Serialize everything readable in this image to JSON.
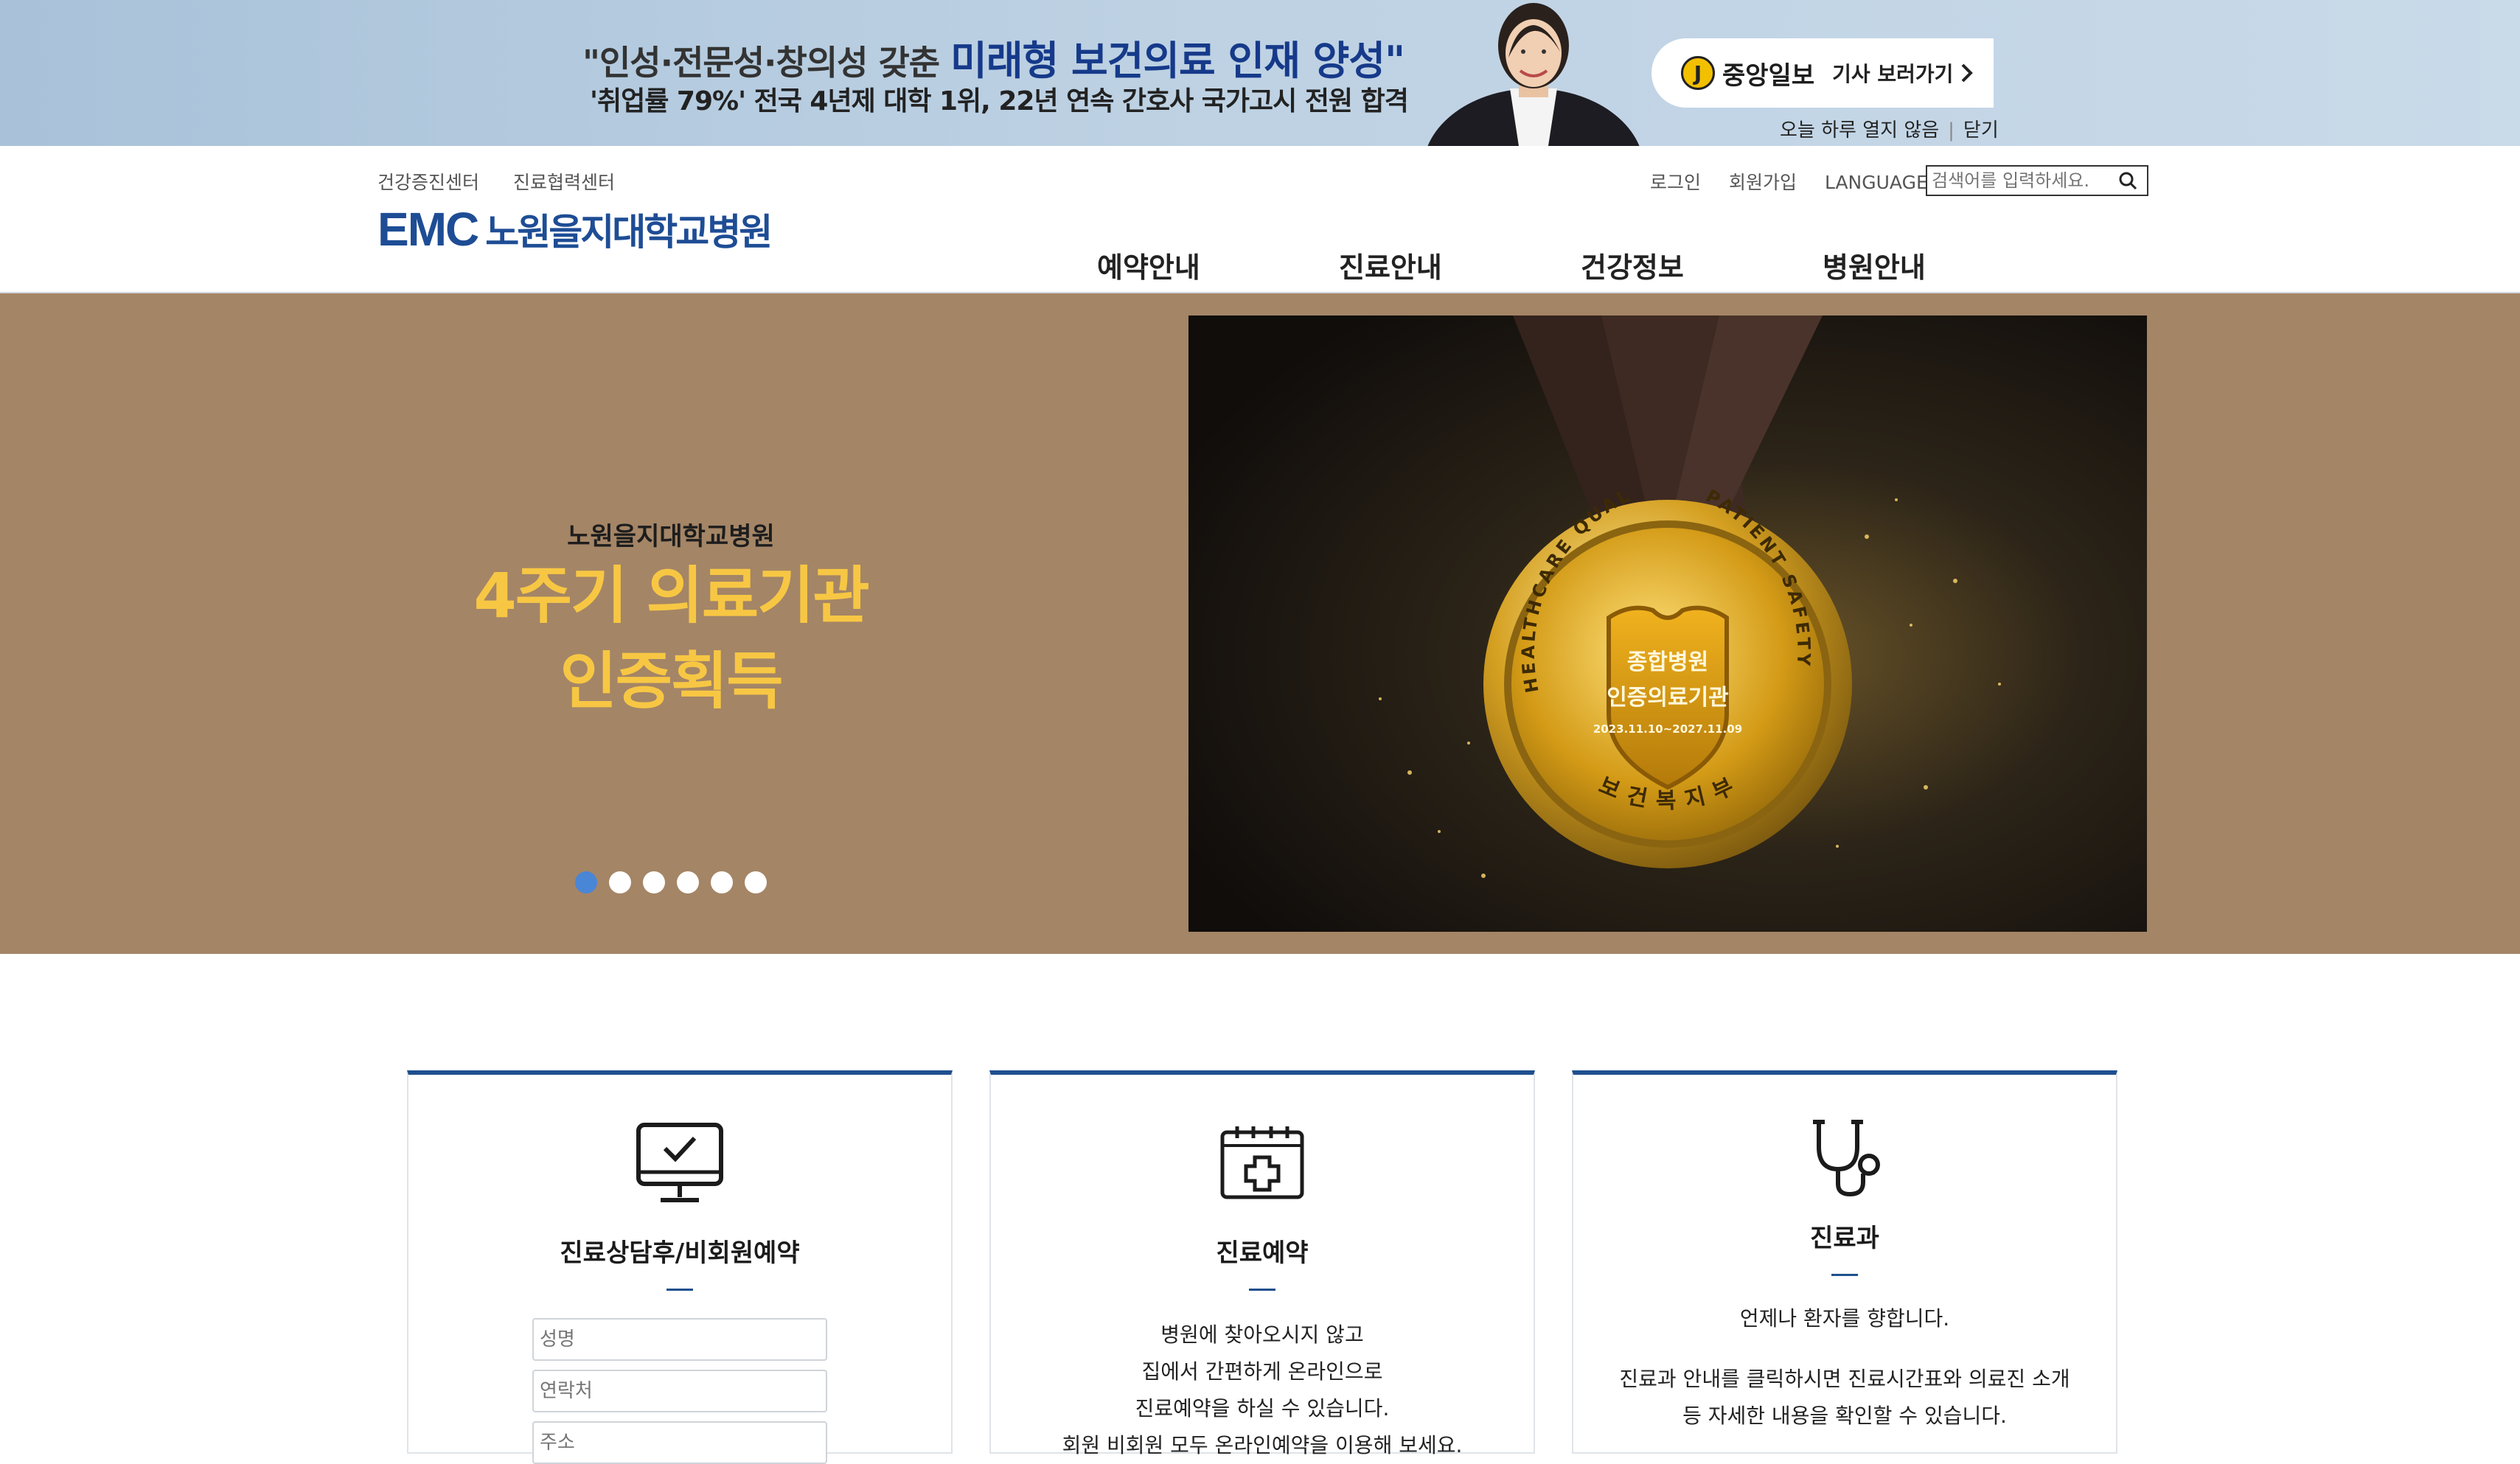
{
  "ad_banner": {
    "line1_prefix": "\"인성·전문성·창의성 갖춘",
    "line1_highlight": "미래형 보건의료 인재 양성\"",
    "line2": "'취업률 79%' 전국 4년제 대학 1위, 22년 연속 간호사 국가고시 전원 합격",
    "newspaper_logo_letter": "J",
    "newspaper_name": "중앙일보",
    "article_link": "기사 보러가기",
    "hide_today": "오늘 하루 열지 않음",
    "close": "닫기"
  },
  "header": {
    "util_left": [
      "건강증진센터",
      "진료협력센터"
    ],
    "util_right": [
      "로그인",
      "회원가입",
      "LANGUAGE"
    ],
    "search_placeholder": "검색어를 입력하세요.",
    "logo_emc": "EMC",
    "logo_name": "노원을지대학교병원",
    "gnb": [
      "예약안내",
      "진료안내",
      "건강정보",
      "병원안내"
    ]
  },
  "hero": {
    "subtitle": "노원을지대학교병원",
    "title_line1": "4주기 의료기관",
    "title_line2": "인증획득",
    "slide_count": 6,
    "active_slide": 1,
    "medal_top_text": "PATIENT SAFETY",
    "medal_left_text": "HEALTHCARE QUALITY",
    "medal_bottom_text": "보건복지부",
    "medal_line1": "종합병원",
    "medal_line2": "인증의료기관",
    "medal_dates": "2023.11.10~2027.11.09"
  },
  "cards": [
    {
      "title": "진료상담후/비회원예약",
      "fields": [
        "성명",
        "연락처",
        "주소"
      ]
    },
    {
      "title": "진료예약",
      "desc": [
        "병원에 찾아오시지 않고",
        "집에서 간편하게 온라인으로",
        "진료예약을 하실 수 있습니다.",
        "회원 비회원 모두 온라인예약을 이용해 보세요."
      ]
    },
    {
      "title": "진료과",
      "desc": [
        "언제나 환자를 향합니다.",
        "진료과 안내를 클릭하시면 진료시간표와 의료진 소개",
        "등 자세한 내용을 확인할 수 있습니다."
      ]
    }
  ],
  "colors": {
    "brand_blue": "#1e4d95",
    "hero_bg": "#a48566",
    "hero_title": "#f7c744",
    "active_dot": "#4a86d6"
  }
}
